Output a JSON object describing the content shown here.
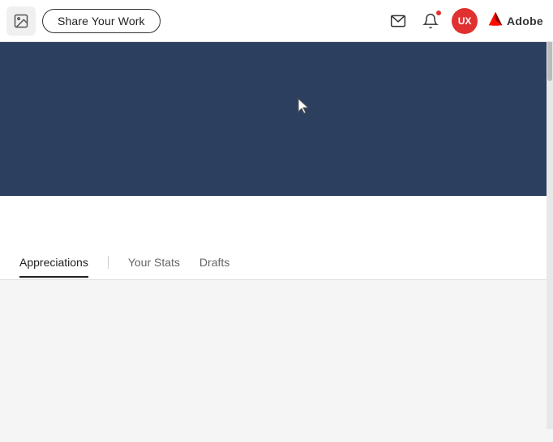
{
  "header": {
    "share_work_label": "Share Your Work",
    "adobe_label": "Adobe",
    "avatar_initials": "UX"
  },
  "hero": {
    "bg_color": "#2d3f5e"
  },
  "tabs": {
    "items": [
      {
        "label": "Appreciations",
        "active": true
      },
      {
        "label": "Your Stats",
        "active": false
      },
      {
        "label": "Drafts",
        "active": false
      }
    ]
  },
  "icons": {
    "image_icon": "🖼",
    "mail_icon": "✉",
    "bell_icon": "🔔",
    "adobe_symbol": "A"
  }
}
